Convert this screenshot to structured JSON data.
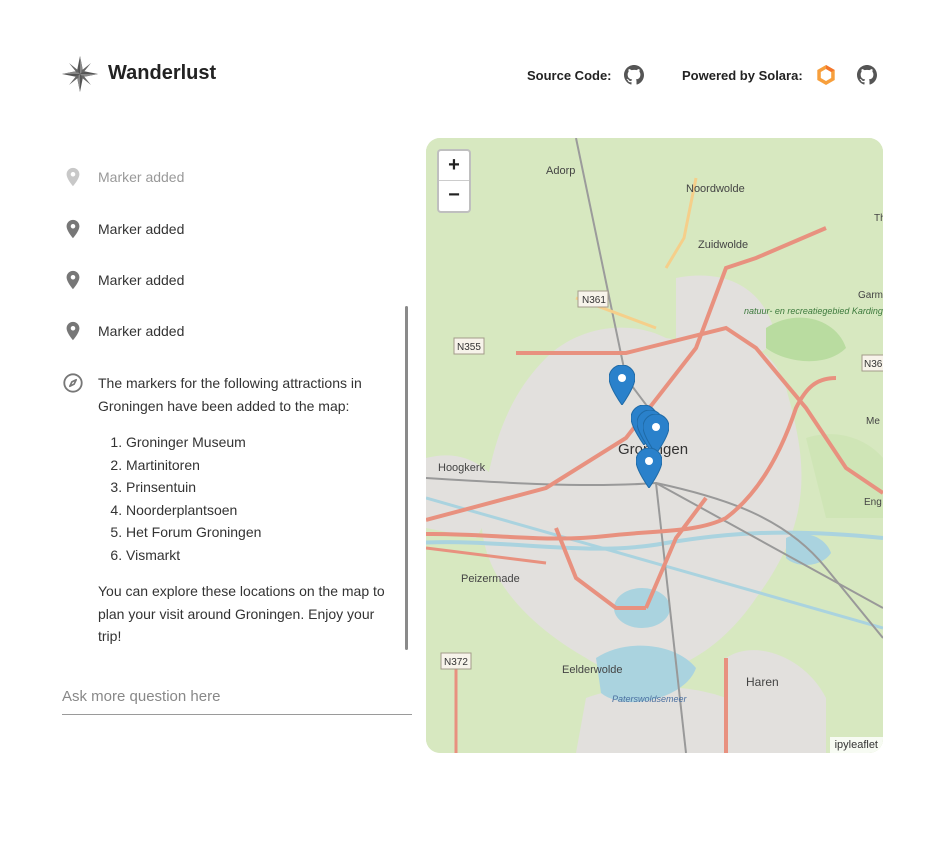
{
  "header": {
    "title": "Wanderlust",
    "source_code_label": "Source Code:",
    "powered_by_label": "Powered by Solara:"
  },
  "chat": {
    "messages": [
      {
        "type": "marker",
        "text": "Marker added",
        "faded": true
      },
      {
        "type": "marker",
        "text": "Marker added"
      },
      {
        "type": "marker",
        "text": "Marker added"
      },
      {
        "type": "marker",
        "text": "Marker added"
      }
    ],
    "assistant": {
      "intro": "The markers for the following attractions in Groningen have been added to the map:",
      "attractions": [
        "Groninger Museum",
        "Martinitoren",
        "Prinsentuin",
        "Noorderplantsoen",
        "Het Forum Groningen",
        "Vismarkt"
      ],
      "outro": "You can explore these locations on the map to plan your visit around Groningen. Enjoy your trip!"
    }
  },
  "input": {
    "placeholder": "Ask more question here"
  },
  "map": {
    "zoom_in": "+",
    "zoom_out": "−",
    "attribution": "ipyleaflet",
    "labels": {
      "city": "Groningen",
      "adorp": "Adorp",
      "noordwolde": "Noordwolde",
      "zuidwolde": "Zuidwolde",
      "hoogkerk": "Hoogkerk",
      "peizermade": "Peizermade",
      "eelderwolde": "Eelderwolde",
      "haren": "Haren",
      "paterswoldsemeer": "Paterswoldsemeer",
      "kardinge": "natuur- en recreatiegebied Kardinge",
      "n361": "N361",
      "n355": "N355",
      "n372": "N372",
      "n36": "N36",
      "garm": "Garm",
      "th": "Th",
      "me": "Me",
      "eng": "Eng"
    }
  },
  "colors": {
    "marker": "#2a81cb",
    "road_major": "#e8917f",
    "water": "#aad3df"
  }
}
